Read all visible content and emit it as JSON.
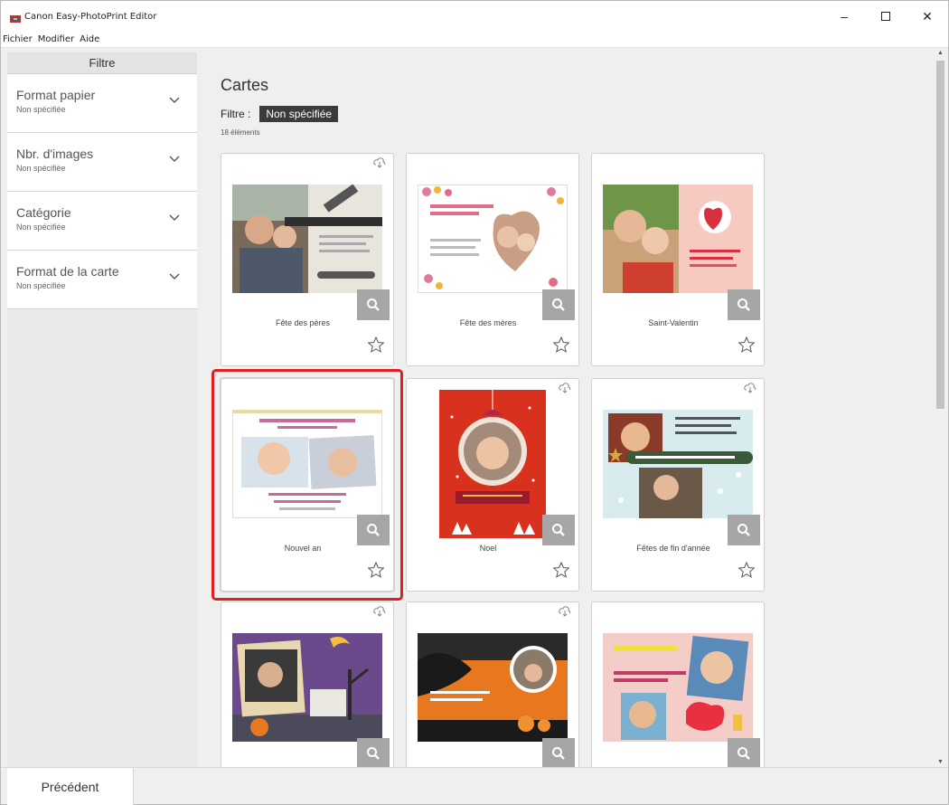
{
  "window": {
    "title": "Canon Easy-PhotoPrint Editor",
    "controls": {
      "minimize": "–",
      "maximize": "☐",
      "close": "✕"
    }
  },
  "menu": [
    "Fichier",
    "Modifier",
    "Aide"
  ],
  "sidebar": {
    "header": "Filtre",
    "filters": [
      {
        "title": "Format papier",
        "value": "Non spécifiée"
      },
      {
        "title": "Nbr. d'images",
        "value": "Non spécifiée"
      },
      {
        "title": "Catégorie",
        "value": "Non spécifiée"
      },
      {
        "title": "Format de la carte",
        "value": "Non spécifiée"
      }
    ]
  },
  "main": {
    "title": "Cartes",
    "filter_label": "Filtre :",
    "filter_value": "Non spécifiée",
    "count": "18 éléments"
  },
  "cards": [
    {
      "label": "Fête des pères",
      "cloud": true,
      "selected": false
    },
    {
      "label": "Fête des mères",
      "cloud": false,
      "selected": false
    },
    {
      "label": "Saint-Valentin",
      "cloud": false,
      "selected": false
    },
    {
      "label": "Nouvel an",
      "cloud": false,
      "selected": true
    },
    {
      "label": "Noel",
      "cloud": true,
      "selected": false
    },
    {
      "label": "Fêtes de fin d'année",
      "cloud": true,
      "selected": false
    },
    {
      "label": "",
      "cloud": true,
      "selected": false
    },
    {
      "label": "",
      "cloud": true,
      "selected": false
    },
    {
      "label": "",
      "cloud": false,
      "selected": false
    }
  ],
  "footer": {
    "prev_label": "Précédent"
  },
  "colors": {
    "selection": "#e02020",
    "chip": "#3b3b3b",
    "zoom": "#a6a6a6"
  }
}
